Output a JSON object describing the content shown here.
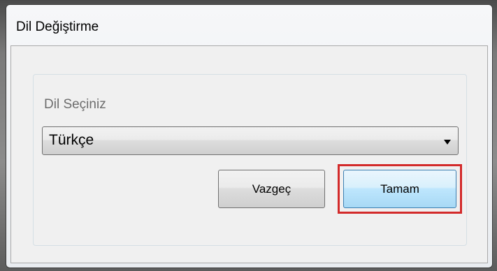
{
  "dialog": {
    "title": "Dil Değiştirme",
    "group_label": "Dil Seçiniz",
    "language_select": {
      "selected": "Türkçe"
    },
    "cancel_label": "Vazgeç",
    "ok_label": "Tamam"
  },
  "colors": {
    "highlight": "#d32a2a",
    "window_bg": "#f0f0f0"
  },
  "icons": {
    "dropdown": "chevron-down-icon"
  }
}
